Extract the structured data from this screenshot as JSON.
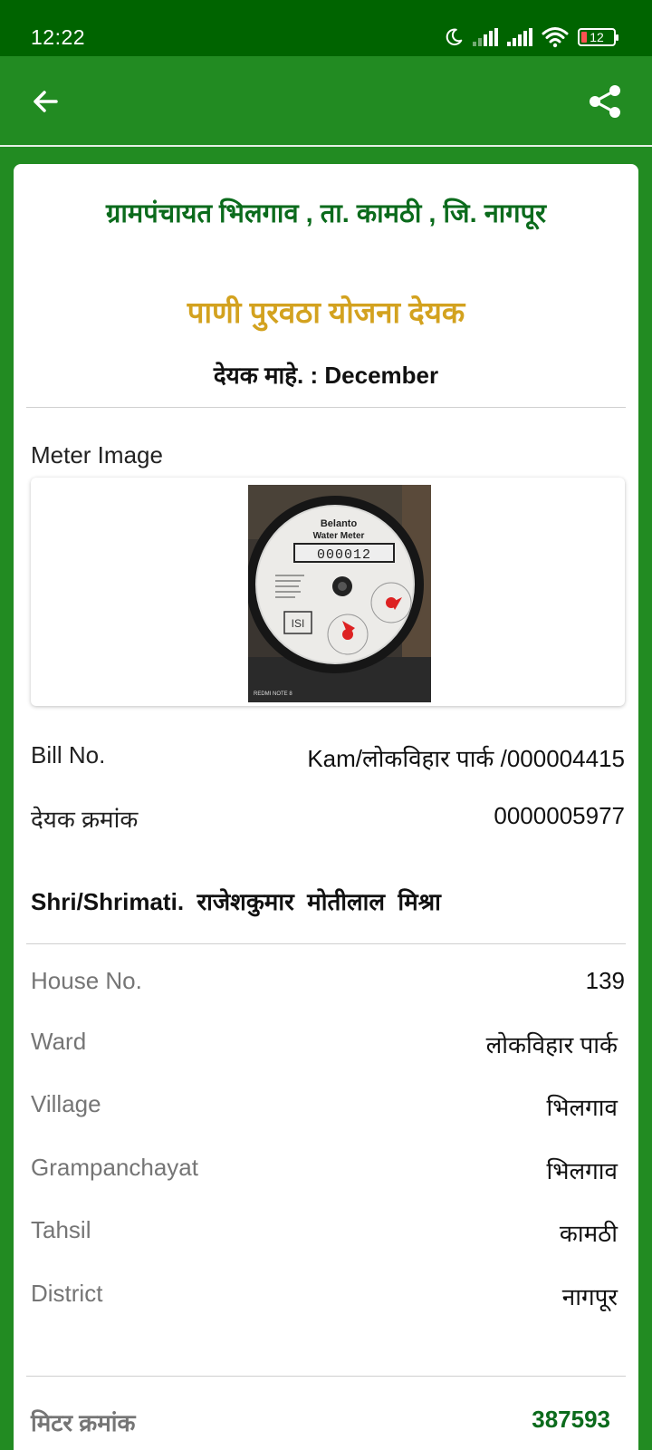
{
  "status_bar": {
    "time": "12:22",
    "battery": "12"
  },
  "bill": {
    "grampanchayat_title": "ग्रामपंचायत भिलगाव , ता. कामठी , जि. नागपूर",
    "scheme_title": "पाणी पुरवठा योजना देयक",
    "month_line": "देयक माहे. : December",
    "meter_image_label": "Meter Image",
    "bill_no_label": "Bill No.",
    "bill_no_value": "Kam/लोकविहार पार्क /000004415",
    "deyak_label": "देयक क्रमांक",
    "deyak_value": "0000005977",
    "owner": "Shri/Shrimati.  राजेशकुमार  मोतीलाल  मिश्रा",
    "details": [
      {
        "label": "House No.",
        "value": "139"
      },
      {
        "label": "Ward",
        "value": "लोकविहार पार्क"
      },
      {
        "label": "Village",
        "value": "भिलगाव"
      },
      {
        "label": "Grampanchayat",
        "value": "भिलगाव"
      },
      {
        "label": "Tahsil",
        "value": "कामठी"
      },
      {
        "label": "District",
        "value": "नागपूर"
      }
    ],
    "meter_no_label": "मिटर क्रमांक",
    "meter_no_value": "387593"
  },
  "meter_photo": {
    "brand": "Belanto",
    "type": "Water Meter",
    "digits": "000012",
    "watermark": "REDMI NOTE 8"
  },
  "colors": {
    "app_green": "#228B22",
    "status_green": "#006400",
    "title_green": "#0b6b1c",
    "title_gold": "#d3a21f",
    "label_grey": "#757575"
  },
  "icons": {
    "back": "arrow-left",
    "share": "share-nodes",
    "dnd": "moon",
    "wifi": "wifi",
    "battery": "battery-low"
  }
}
